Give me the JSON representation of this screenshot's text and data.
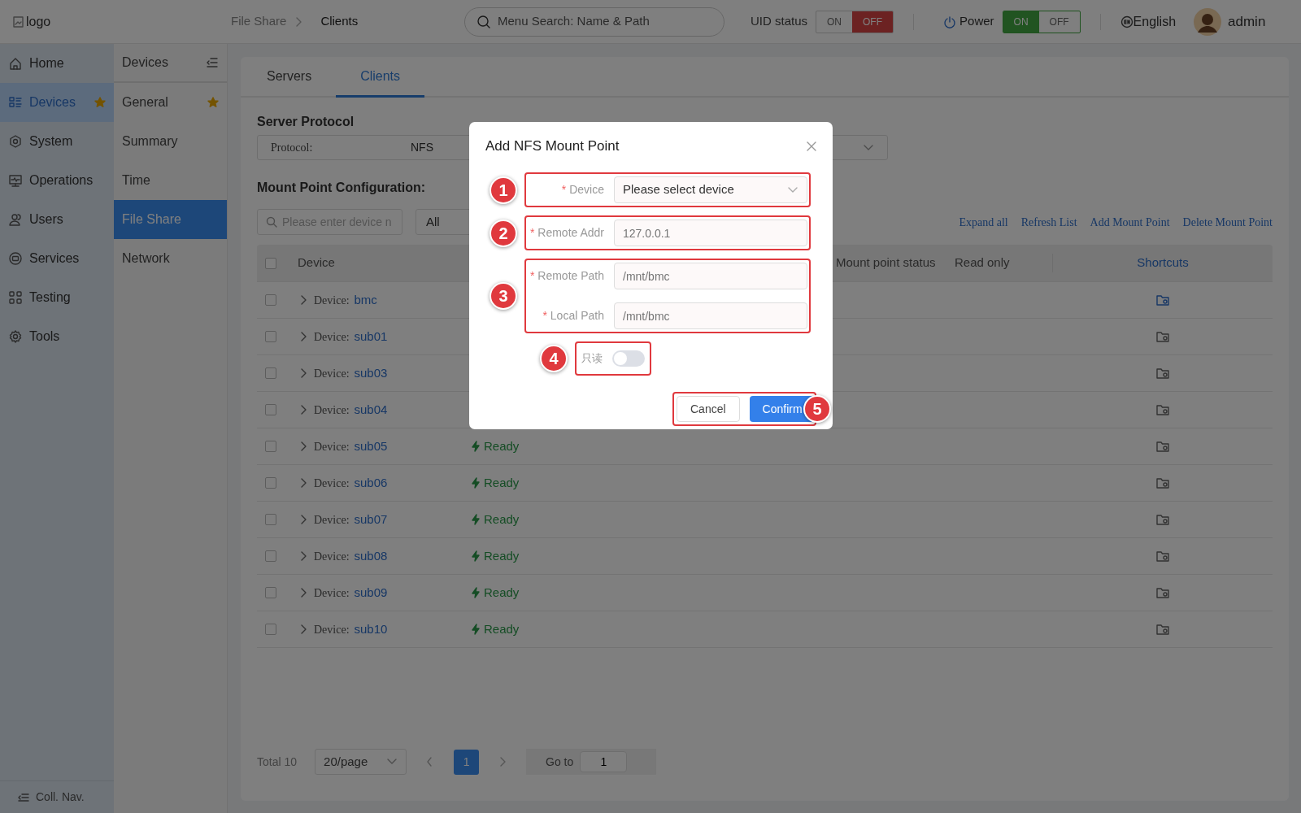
{
  "header": {
    "logo_alt": "logo",
    "breadcrumb": [
      "File Share",
      "Clients"
    ],
    "search": {
      "placeholder": "Menu Search: Name & Path"
    },
    "uid_status": {
      "label": "UID status",
      "options": [
        {
          "label": "ON",
          "selected": false
        },
        {
          "label": "OFF",
          "selected": true
        }
      ]
    },
    "power": {
      "label": "Power",
      "options": [
        {
          "label": "ON",
          "selected": true
        },
        {
          "label": "OFF",
          "selected": false
        }
      ]
    },
    "language": "English",
    "user": "admin"
  },
  "nav": {
    "items": [
      {
        "label": "Home",
        "selected": false,
        "starred": false
      },
      {
        "label": "Devices",
        "selected": true,
        "starred": true
      },
      {
        "label": "System",
        "selected": false,
        "starred": false
      },
      {
        "label": "Operations",
        "selected": false,
        "starred": false
      },
      {
        "label": "Users",
        "selected": false,
        "starred": false
      },
      {
        "label": "Services",
        "selected": false,
        "starred": false
      },
      {
        "label": "Testing",
        "selected": false,
        "starred": false
      },
      {
        "label": "Tools",
        "selected": false,
        "starred": false
      }
    ],
    "collapse_label": "Coll. Nav."
  },
  "subnav": {
    "title": "Devices",
    "items": [
      {
        "label": "General",
        "selected": false,
        "starred": true
      },
      {
        "label": "Summary",
        "selected": false,
        "starred": false
      },
      {
        "label": "Time",
        "selected": false,
        "starred": false
      },
      {
        "label": "File Share",
        "selected": true,
        "starred": false
      },
      {
        "label": "Network",
        "selected": false,
        "starred": false
      }
    ]
  },
  "tabs": [
    {
      "label": "Servers",
      "selected": false
    },
    {
      "label": "Clients",
      "selected": true
    }
  ],
  "server_protocol": {
    "title": "Server Protocol",
    "label": "Protocol:",
    "value": "NFS"
  },
  "mount_config": {
    "title": "Mount Point Configuration:",
    "search": {
      "placeholder": "Please enter device n"
    },
    "filter": "All",
    "actions": [
      "Expand all",
      "Refresh List",
      "Add Mount Point",
      "Delete Mount Point"
    ]
  },
  "table": {
    "header_checked": false,
    "columns": [
      {
        "label": "Device"
      },
      {
        "label": "Mount point status"
      },
      {
        "label": "Read only"
      },
      {
        "label": "Shortcuts"
      }
    ],
    "rows": [
      {
        "checked": false,
        "device_label": "Device:",
        "device": "bmc",
        "shortcut_active": true
      },
      {
        "checked": false,
        "device_label": "Device:",
        "device": "sub01",
        "shortcut_active": false
      },
      {
        "checked": false,
        "device_label": "Device:",
        "device": "sub03",
        "shortcut_active": false
      },
      {
        "checked": false,
        "device_label": "Device:",
        "device": "sub04",
        "shortcut_active": false
      },
      {
        "checked": false,
        "device_label": "Device:",
        "device": "sub05",
        "status": "Ready",
        "shortcut_active": false
      },
      {
        "checked": false,
        "device_label": "Device:",
        "device": "sub06",
        "status": "Ready",
        "shortcut_active": false
      },
      {
        "checked": false,
        "device_label": "Device:",
        "device": "sub07",
        "status": "Ready",
        "shortcut_active": false
      },
      {
        "checked": false,
        "device_label": "Device:",
        "device": "sub08",
        "status": "Ready",
        "shortcut_active": false
      },
      {
        "checked": false,
        "device_label": "Device:",
        "device": "sub09",
        "status": "Ready",
        "shortcut_active": false
      },
      {
        "checked": false,
        "device_label": "Device:",
        "device": "sub10",
        "status": "Ready",
        "shortcut_active": false
      }
    ]
  },
  "pagination": {
    "total": "Total 10",
    "page_size": "20/page",
    "pages": [
      {
        "label": "1",
        "selected": true
      }
    ],
    "goto_label": "Go to",
    "goto_value": "1"
  },
  "dialog": {
    "title": "Add NFS Mount Point",
    "groups": [
      {
        "callout": "1",
        "fields": [
          {
            "kind": "select",
            "required_mark": "*",
            "label": "Device",
            "placeholder": "Please select device"
          }
        ]
      },
      {
        "callout": "2",
        "fields": [
          {
            "kind": "input",
            "required_mark": "*",
            "label": "Remote Addr",
            "placeholder": "127.0.0.1"
          }
        ]
      },
      {
        "callout": "3",
        "fields": [
          {
            "kind": "input",
            "required_mark": "*",
            "label": "Remote Path",
            "placeholder": "/mnt/bmc"
          },
          {
            "kind": "input",
            "required_mark": "*",
            "label": "Local Path",
            "placeholder": "/mnt/bmc"
          }
        ]
      },
      {
        "callout": "4",
        "fields": [
          {
            "kind": "switch",
            "label": "只读",
            "on": false
          }
        ]
      }
    ],
    "buttons": [
      {
        "label": "Cancel",
        "kind": "default"
      },
      {
        "label": "Confirm",
        "kind": "primary"
      }
    ],
    "buttons_callout": "5"
  }
}
